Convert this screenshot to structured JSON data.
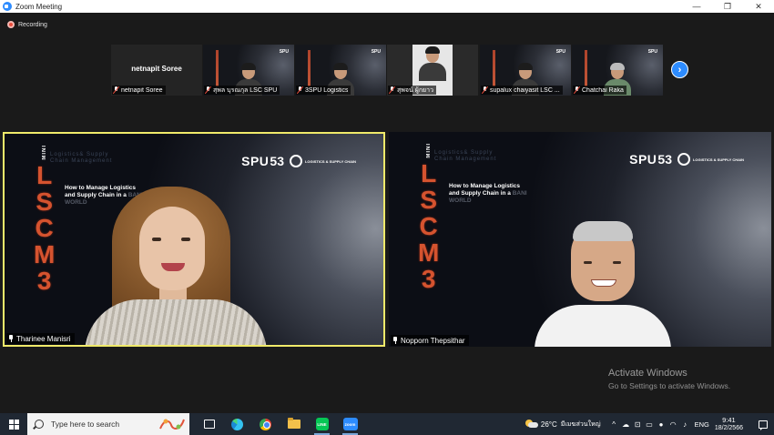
{
  "window": {
    "title": "Zoom Meeting",
    "controls": {
      "minimize": "—",
      "restore": "❐",
      "close": "✕"
    }
  },
  "recording": {
    "label": "Recording"
  },
  "gallery": {
    "tiles": [
      {
        "name": "netnapit Soree",
        "display_name": "netnapit Soree",
        "has_video": false
      },
      {
        "name": "สุพล บุรณกุล LSC SPU",
        "has_video": true
      },
      {
        "name": "3SPU Logistics",
        "has_video": true
      },
      {
        "name": "สุพจน์ ผู้กยาว",
        "has_video": true
      },
      {
        "name": "supalux chaiyasit LSC ...",
        "has_video": true
      },
      {
        "name": "Chatchai Raka",
        "has_video": true
      }
    ],
    "next_label": "›"
  },
  "slide": {
    "mini": "MINI",
    "letters": [
      "L",
      "S",
      "C",
      "M",
      "3"
    ],
    "subtitle": "Logistics& Supply Chain Management",
    "headline": "How to Manage Logistics and Supply Chain in a",
    "headline_dim": "BANI WORLD",
    "spu": "SPU",
    "spu_num": "53",
    "lsc": "LOGISTICS & SUPPLY CHAIN"
  },
  "main_videos": [
    {
      "name": "Tharinee Manisri",
      "active": true
    },
    {
      "name": "Nopporn Thepsithar",
      "active": false
    }
  ],
  "watermark": {
    "line1": "Activate Windows",
    "line2": "Go to Settings to activate Windows."
  },
  "taskbar": {
    "search_placeholder": "Type here to search",
    "apps": [
      "task-view",
      "edge",
      "chrome",
      "file-explorer",
      "line",
      "zoom"
    ],
    "line_label": "LINE",
    "zoom_label": "zoom",
    "weather": {
      "temp": "26°C",
      "text": "มีเมฆส่วนใหญ่"
    },
    "tray_icons": {
      "chevron": "^",
      "lang": "ENG"
    },
    "clock": {
      "time": "9:41",
      "date": "18/2/2566"
    }
  }
}
